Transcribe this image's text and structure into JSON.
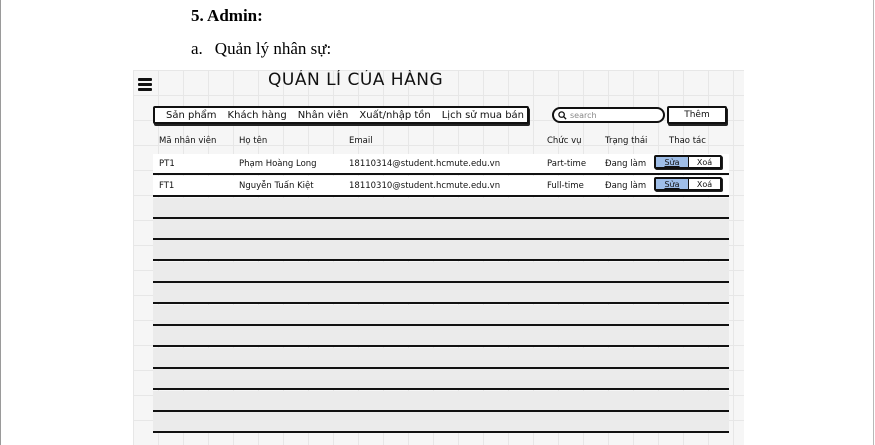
{
  "document": {
    "heading": "5. Admin:",
    "subheading_marker": "a.",
    "subheading_text": "Quản lý nhân sự:"
  },
  "app": {
    "title": "QUẢN LÍ CỦA HÀNG",
    "menu_icon": "hamburger-icon"
  },
  "nav": {
    "items": [
      "Sản phẩm",
      "Khách hàng",
      "Nhân viên",
      "Xuất/nhập tồn",
      "Lịch sử mua bán"
    ]
  },
  "search": {
    "placeholder": "search",
    "icon": "search-icon"
  },
  "toolbar": {
    "add_label": "Thêm"
  },
  "table": {
    "columns": [
      "Mã nhân viên",
      "Họ tên",
      "Email",
      "Chức vụ",
      "Trạng thái",
      "Thao tác"
    ],
    "rows": [
      {
        "id": "PT1",
        "name": "Phạm Hoàng Long",
        "email": "18110314@student.hcmute.edu.vn",
        "role": "Part-time",
        "status": "Đang làm",
        "edit": "Sửa",
        "delete": "Xoá"
      },
      {
        "id": "FT1",
        "name": "Nguyễn Tuấn Kiệt",
        "email": "18110310@student.hcmute.edu.vn",
        "role": "Full-time",
        "status": "Đang làm",
        "edit": "Sửa",
        "delete": "Xoá"
      }
    ]
  },
  "colors": {
    "edit_highlight": "#9fbee8",
    "grid_background": "#f6f6f6"
  }
}
